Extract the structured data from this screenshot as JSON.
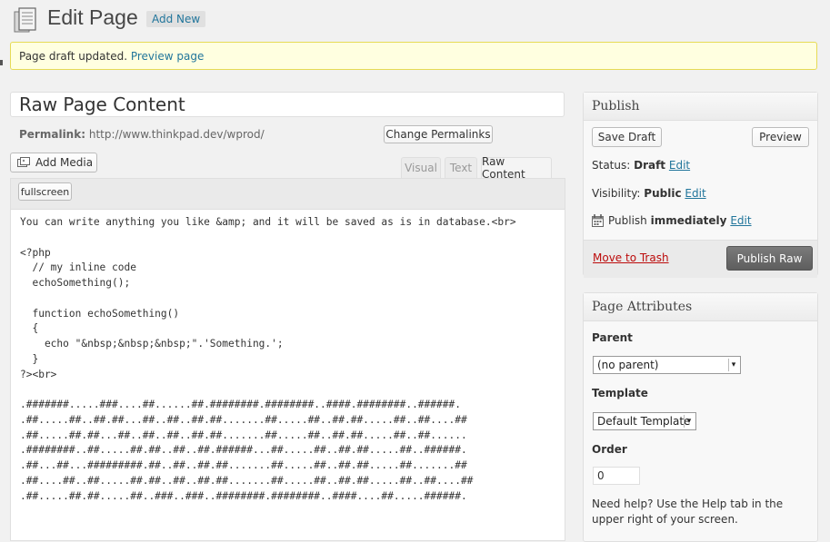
{
  "header": {
    "title": "Edit Page",
    "add_new_label": "Add New"
  },
  "notice": {
    "text": "Page draft updated.",
    "link_label": "Preview page"
  },
  "post": {
    "title": "Raw Page Content",
    "permalink_label": "Permalink:",
    "permalink_url": "http://www.thinkpad.dev/wprod/",
    "change_permalinks_label": "Change Permalinks"
  },
  "editor": {
    "add_media_label": "Add Media",
    "tabs": [
      {
        "label": "Visual",
        "active": false
      },
      {
        "label": "Text",
        "active": false
      },
      {
        "label": "Raw Content",
        "active": true
      }
    ],
    "fullscreen_label": "fullscreen",
    "content": "You can write anything you like &amp; and it will be saved as is in database.<br>\n\n<?php\n  // my inline code\n  echoSomething();\n\n  function echoSomething()\n  {\n    echo \"&nbsp;&nbsp;&nbsp;\".'Something.';\n  }\n?><br>\n\n.#######.....###....##......##.########.########..####.########..######.\n.##.....##..##.##...##..##..##.##.......##.....##..##.##.....##..##....##\n.##.....##.##...##..##..##..##.##.......##.....##..##.##.....##..##......\n.########..##.....##.##..##..##.######...##.....##..##.##.....##..######.\n.##...##...#########.##..##..##.##.......##.....##..##.##.....##.......##\n.##....##..##.....##.##..##..##.##.......##.....##..##.##.....##..##....##\n.##.....##.##.....##..###..###..########.########..####....##.....######."
  },
  "publish": {
    "title": "Publish",
    "save_draft_label": "Save Draft",
    "preview_label": "Preview",
    "status_label": "Status:",
    "status_value": "Draft",
    "visibility_label": "Visibility:",
    "visibility_value": "Public",
    "publish_label": "Publish",
    "publish_value": "immediately",
    "edit_label": "Edit",
    "trash_label": "Move to Trash",
    "publish_button_label": "Publish Raw"
  },
  "attributes": {
    "title": "Page Attributes",
    "parent_label": "Parent",
    "parent_value": "(no parent)",
    "template_label": "Template",
    "template_value": "Default Template",
    "order_label": "Order",
    "order_value": "0",
    "help_text": "Need help? Use the Help tab in the upper right of your screen."
  },
  "colors": {
    "link": "#21759b",
    "notice_bg": "#ffffe0",
    "notice_border": "#e6db55",
    "trash": "#bc0b0b",
    "primary_button": "#6e6e6e"
  },
  "icons": {
    "page": "pages-icon",
    "media": "media-icon",
    "calendar": "calendar-icon"
  }
}
